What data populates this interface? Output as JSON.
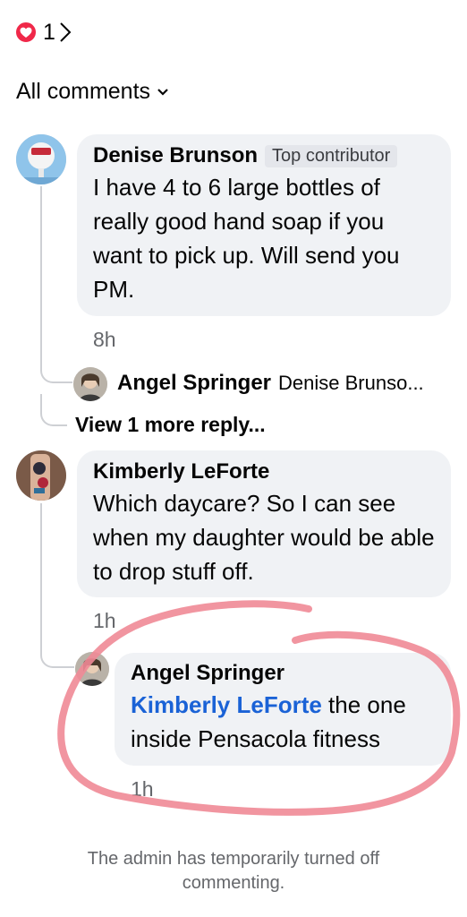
{
  "reactions": {
    "count": "1",
    "icon": "heart-icon",
    "heart_color": "#f02849"
  },
  "filter": {
    "label": "All comments"
  },
  "comments": [
    {
      "author": "Denise Brunson",
      "badge": "Top contributor",
      "text": "I have 4 to 6 large bottles of really good hand soap if you want to pick up. Will send you PM.",
      "time": "8h",
      "reply_preview": {
        "author": "Angel Springer",
        "snippet": "Denise Brunso..."
      },
      "view_more": "View 1 more reply..."
    },
    {
      "author": "Kimberly LeForte",
      "text": "Which daycare? So I can see when my daughter would be able to drop stuff off.",
      "time": "1h",
      "reply": {
        "author": "Angel Springer",
        "mention": "Kimberly LeForte",
        "text": " the one inside Pensacola fitness",
        "time": "1h"
      }
    }
  ],
  "footer": {
    "note": "The admin has temporarily turned off commenting."
  },
  "colors": {
    "bubble_bg": "#f0f2f5",
    "mention": "#1a62d6",
    "secondary_text": "#65676b",
    "annotation": "#f08a96"
  }
}
